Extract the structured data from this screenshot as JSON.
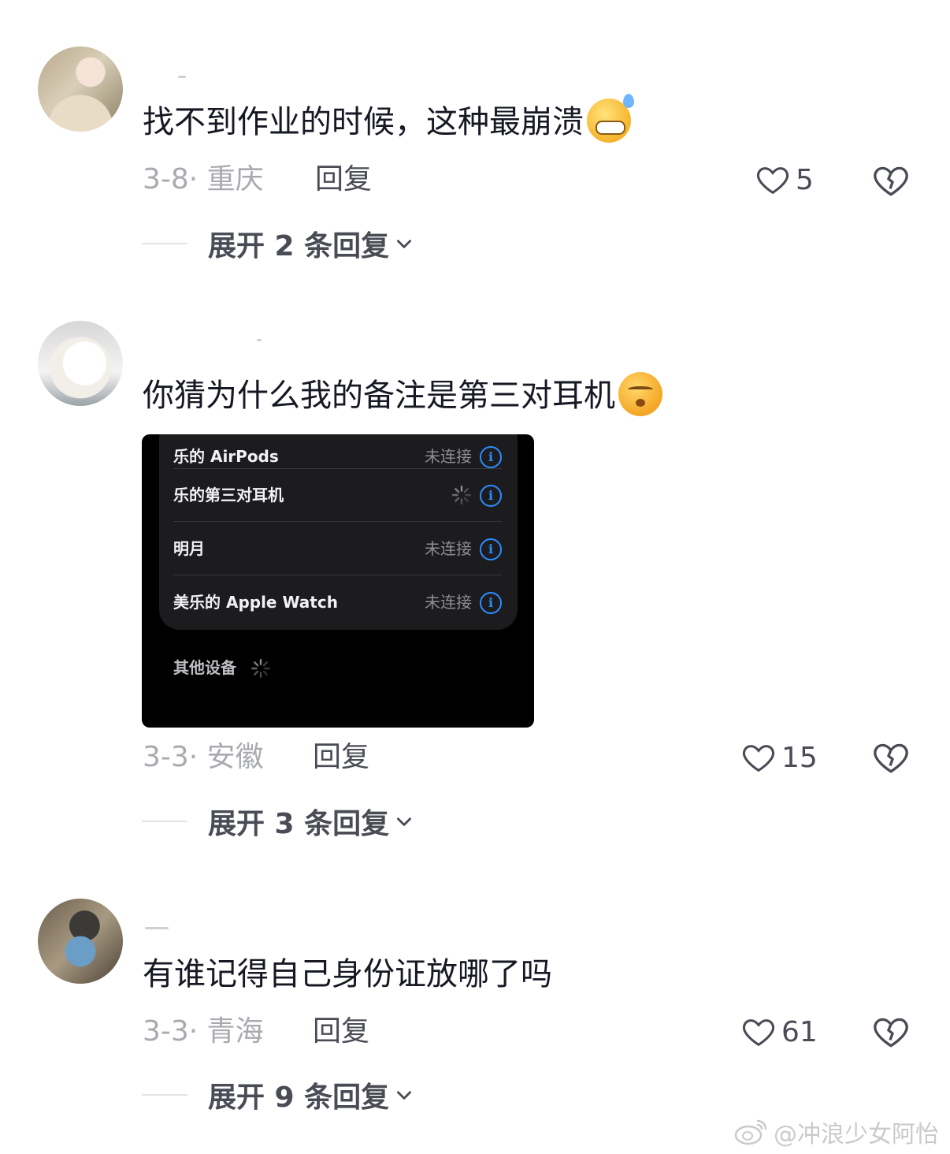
{
  "comments": [
    {
      "text": "找不到作业的时候，这种最崩溃",
      "emoji": "grimacing-sweat-emoji",
      "meta": "3-8· 重庆",
      "reply_label": "回复",
      "likes": "5",
      "expand_label": "展开 2 条回复"
    },
    {
      "text": "你猜为什么我的备注是第三对耳机",
      "emoji": "smirk-emoji",
      "meta": "3-3· 安徽",
      "reply_label": "回复",
      "likes": "15",
      "expand_label": "展开 3 条回复",
      "screenshot": {
        "devices": [
          {
            "name": "乐的 AirPods",
            "status": "未连接"
          },
          {
            "name": "乐的第三对耳机",
            "status": ""
          },
          {
            "name": "明月",
            "status": "未连接"
          },
          {
            "name": "美乐的 Apple Watch",
            "status": "未连接"
          }
        ],
        "other_devices_label": "其他设备"
      }
    },
    {
      "text": "有谁记得自己身份证放哪了吗",
      "meta": "3-3· 青海",
      "reply_label": "回复",
      "likes": "61",
      "expand_label": "展开 9 条回复"
    }
  ],
  "watermark": "@冲浪少女阿怡",
  "colors": {
    "meta_gray": "#a8aab0",
    "action_gray": "#4a4c55",
    "info_blue": "#2c8cff"
  }
}
